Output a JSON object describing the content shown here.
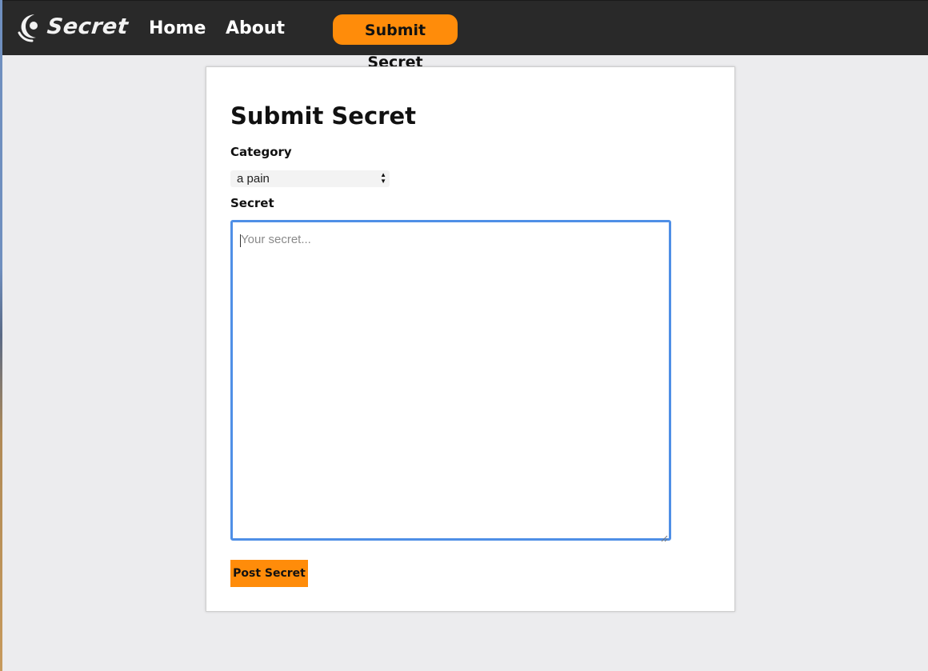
{
  "navbar": {
    "logo_text": "Secret",
    "links": {
      "home": "Home",
      "about": "About"
    },
    "submit_button": "Submit Secret",
    "background_color": "#292929",
    "accent_color": "#ff8c0a"
  },
  "form": {
    "title": "Submit Secret",
    "category_label": "Category",
    "category_selected": "a pain",
    "secret_label": "Secret",
    "secret_placeholder": "Your secret...",
    "secret_value": "",
    "submit_label": "Post Secret",
    "focus_color": "#4f8fe6"
  },
  "icons": {
    "logo": "crescent-logo-icon",
    "select_arrows": "up-down-arrows-icon",
    "resize": "resize-grip-icon"
  }
}
